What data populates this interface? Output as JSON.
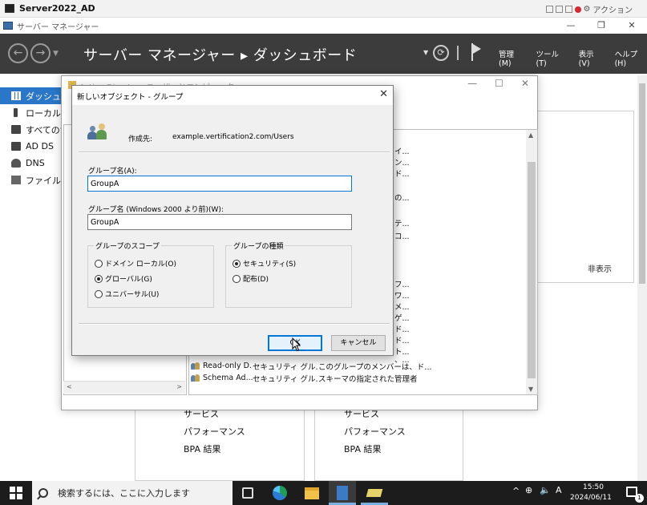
{
  "vm_window": {
    "title": "Server2022_AD",
    "action_label": "アクション"
  },
  "server_manager": {
    "title": "サーバー マネージャー",
    "breadcrumb": "サーバー マネージャー ▸ ダッシュボード",
    "menus": [
      "管理(M)",
      "ツール(T)",
      "表示(V)",
      "ヘルプ(H)"
    ],
    "sidebar": [
      {
        "label": "ダッシュボード",
        "icon": "dashboard-icon",
        "active": true
      },
      {
        "label": "ローカル サーバー",
        "icon": "server-icon",
        "active": false
      },
      {
        "label": "すべてのサーバー",
        "icon": "servers-icon",
        "active": false
      },
      {
        "label": "AD DS",
        "icon": "ad-ds-icon",
        "active": false
      },
      {
        "label": "DNS",
        "icon": "dns-icon",
        "active": false
      },
      {
        "label": "ファイル サービス",
        "icon": "file-services-icon",
        "active": false
      }
    ],
    "hide_label": "非表示",
    "tiles": {
      "left": [
        "サービス",
        "パフォーマンス",
        "BPA 結果"
      ],
      "right": [
        "サービス",
        "パフォーマンス",
        "BPA 結果"
      ]
    }
  },
  "aduc": {
    "title": "Active Directory ユーザーとコンピューター",
    "fragments": [
      "イ...",
      "ン...",
      "ド...",
      "の...",
      "テ...",
      "コ...",
      "フ...",
      "ワ...",
      "メ...",
      "ゲ...",
      "ド...",
      "ド...",
      "ト...",
      "、..."
    ],
    "rows": [
      {
        "name": "Read-only D...",
        "type": "セキュリティ グル...",
        "desc": "このグループのメンバーは、ド..."
      },
      {
        "name": "Schema Ad...",
        "type": "セキュリティ グル...",
        "desc": "スキーマの指定された管理者"
      }
    ]
  },
  "dialog": {
    "title": "新しいオブジェクト - グループ",
    "create_in_label": "作成先:",
    "create_in_path": "example.vertification2.com/Users",
    "group_name_label": "グループ名(A):",
    "group_name_value": "GroupA",
    "group_name_pre2000_label": "グループ名 (Windows 2000 より前)(W):",
    "group_name_pre2000_value": "GroupA",
    "scope": {
      "legend": "グループのスコープ",
      "options": [
        {
          "label": "ドメイン ローカル(O)",
          "checked": false
        },
        {
          "label": "グローバル(G)",
          "checked": true
        },
        {
          "label": "ユニバーサル(U)",
          "checked": false
        }
      ]
    },
    "type": {
      "legend": "グループの種類",
      "options": [
        {
          "label": "セキュリティ(S)",
          "checked": true
        },
        {
          "label": "配布(D)",
          "checked": false
        }
      ]
    },
    "ok_label": "OK",
    "cancel_label": "キャンセル"
  },
  "taskbar": {
    "search_placeholder": "検索するには、ここに入力します",
    "ime_label": "A",
    "time": "15:50",
    "date": "2024/06/11",
    "notification_count": "1"
  }
}
